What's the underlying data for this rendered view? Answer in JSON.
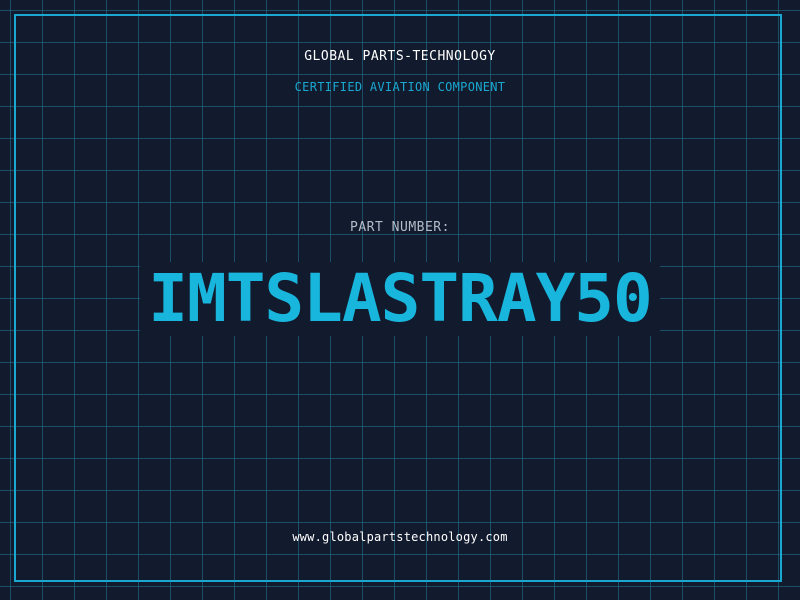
{
  "header": {
    "company": "GLOBAL PARTS-TECHNOLOGY",
    "subtitle": "CERTIFIED AVIATION COMPONENT"
  },
  "part": {
    "label": "PART NUMBER:",
    "number": "IMTSLASTRAY50"
  },
  "footer": {
    "website": "www.globalpartstechnology.com"
  },
  "colors": {
    "background": "#121a2e",
    "grid": "#267896",
    "accent": "#1aa8d0",
    "text": "#ffffff"
  }
}
